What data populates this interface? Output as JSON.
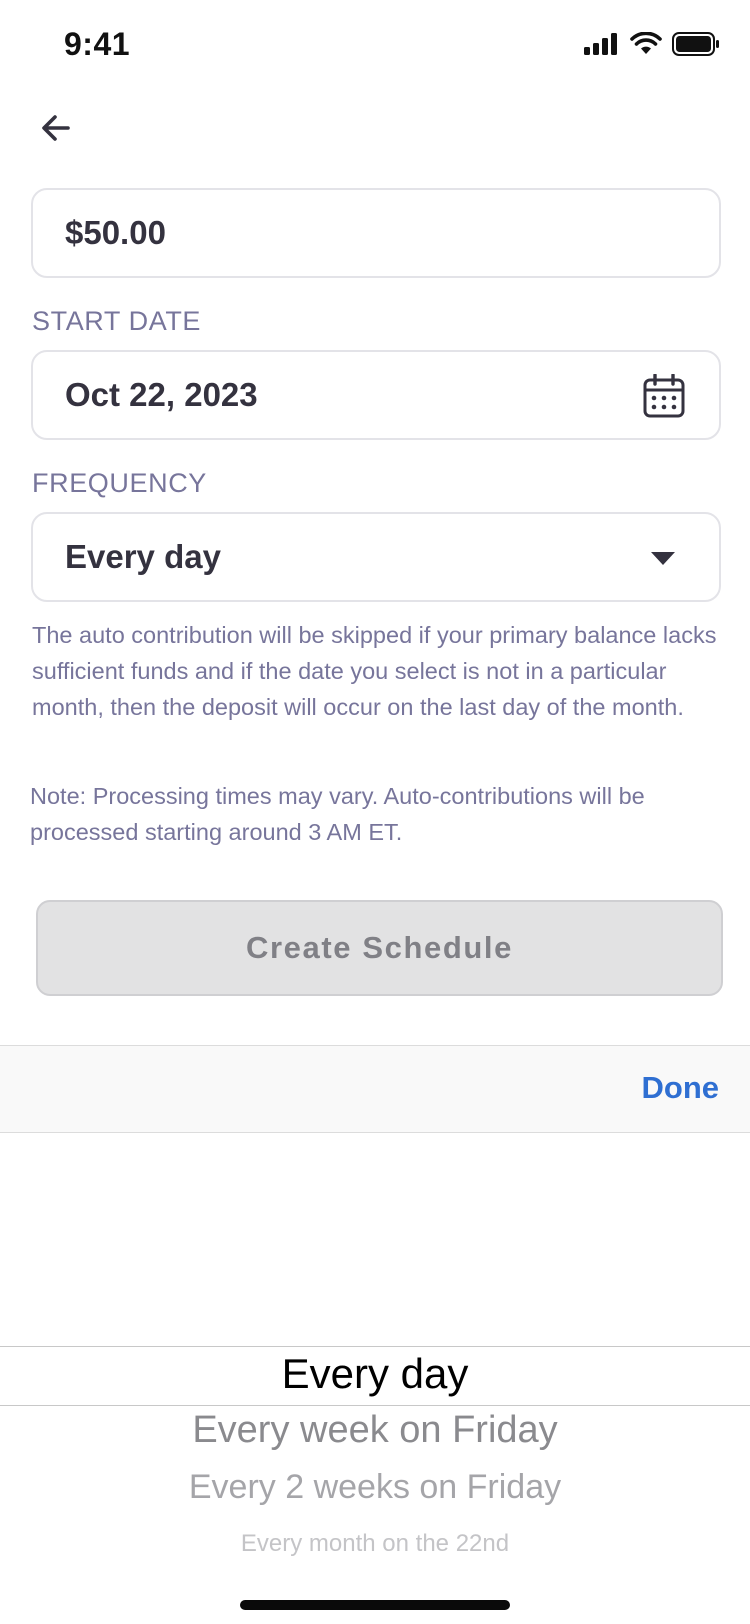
{
  "status_bar": {
    "time": "9:41",
    "icons": [
      "signal-icon",
      "wifi-icon",
      "battery-icon"
    ]
  },
  "nav": {
    "back_icon": "arrow-left-icon"
  },
  "amount": {
    "value": "$50.00"
  },
  "start_date": {
    "label": "START DATE",
    "value": "Oct 22, 2023",
    "icon": "calendar-icon"
  },
  "frequency": {
    "label": "FREQUENCY",
    "value": "Every day",
    "icon": "caret-down-icon"
  },
  "info": {
    "skip_notice": "The auto contribution will be skipped if your primary balance lacks sufficient funds and if the date you select is not in a particular month, then the deposit will occur on the last day of the month.",
    "processing_note": "Note: Processing times may vary. Auto-contributions will be processed starting around 3 AM ET."
  },
  "create_button": {
    "label": "Create Schedule",
    "enabled": false
  },
  "picker": {
    "done_label": "Done",
    "options": [
      "Every day",
      "Every week on Friday",
      "Every 2 weeks on Friday",
      "Every month on the 22nd"
    ],
    "selected": "Every day"
  },
  "colors": {
    "label": "#77759b",
    "text": "#34323f",
    "accent": "#2f6fd2",
    "disabled_bg": "#e2e2e3",
    "disabled_text": "#808086"
  }
}
